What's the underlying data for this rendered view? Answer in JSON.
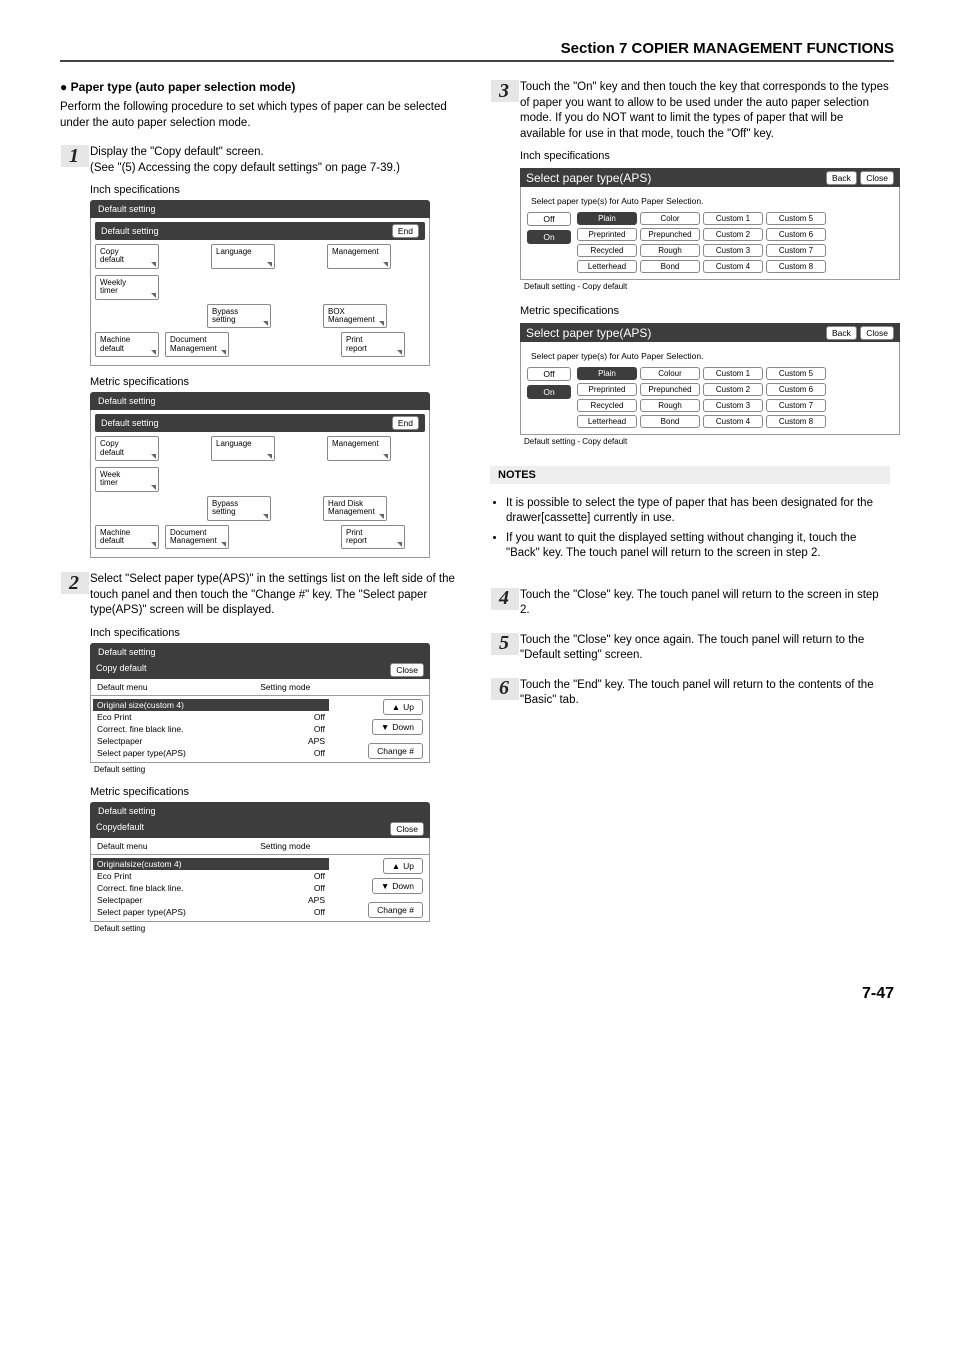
{
  "header": {
    "section_title": "Section 7  COPIER MANAGEMENT FUNCTIONS"
  },
  "left": {
    "heading": "Paper type (auto paper selection mode)",
    "intro": "Perform the following procedure to set which types of paper can be selected under the auto paper selection mode.",
    "step1_line1": "Display the \"Copy default\" screen.",
    "step1_line2": "(See \"(5) Accessing the copy default settings\" on page 7-39.)",
    "spec_inch": "Inch specifications",
    "spec_metric": "Metric specifications",
    "default_setting": "Default setting",
    "end": "End",
    "buttons_inch": {
      "copy_default": "Copy\ndefault",
      "machine_default": "Machine\ndefault",
      "document_mgmt": "Document\nManagement",
      "language": "Language",
      "bypass": "Bypass\nsetting",
      "management": "Management",
      "box_mgmt": "BOX\nManagement",
      "print_report": "Print\nreport",
      "weekly_timer": "Weekly\ntimer"
    },
    "buttons_metric": {
      "copy_default": "Copy\ndefault",
      "machine_default": "Machine\ndefault",
      "document_mgmt": "Document\nManagement",
      "language": "Language",
      "bypass": "Bypass\nsetting",
      "management": "Management",
      "hd_mgmt": "Hard Disk\nManagement",
      "print_report": "Print\nreport",
      "week_timer": "Week\ntimer"
    },
    "step2": "Select \"Select paper type(APS)\" in the settings list on the left side of the touch panel and then touch the \"Change #\" key. The \"Select paper type(APS)\" screen will be displayed.",
    "list_inch": {
      "title": "Default setting",
      "bar": "Copy default",
      "close": "Close",
      "menu": "Default menu",
      "mode": "Setting mode",
      "rows": [
        [
          "Original size(custom 4)",
          ""
        ],
        [
          "Eco Print",
          "Off"
        ],
        [
          "Correct. fine black line.",
          "Off"
        ],
        [
          "Selectpaper",
          "APS"
        ],
        [
          "Select paper type(APS)",
          "Off"
        ]
      ],
      "up": "Up",
      "down": "Down",
      "change": "Change #",
      "footer": "Default setting"
    },
    "list_metric": {
      "title": "Default setting",
      "bar": "Copydefault",
      "close": "Close",
      "menu": "Default menu",
      "mode": "Setting mode",
      "rows": [
        [
          "Originalsize(custom 4)",
          ""
        ],
        [
          "Eco Print",
          "Off"
        ],
        [
          "Correct. fine black line.",
          "Off"
        ],
        [
          "Selectpaper",
          "APS"
        ],
        [
          "Select paper type(APS)",
          "Off"
        ]
      ],
      "up": "Up",
      "down": "Down",
      "change": "Change #",
      "footer": "Default setting"
    }
  },
  "right": {
    "step3": "Touch the \"On\" key and then touch the key that corresponds to the types of paper you want to allow to be used under the auto paper selection mode. If you do NOT want to limit the types of paper that will be available for use in that mode, touch the \"Off\" key.",
    "spec_inch": "Inch specifications",
    "spec_metric": "Metric specifications",
    "aps_inch": {
      "title": "Select paper type(APS)",
      "back": "Back",
      "close": "Close",
      "sub": "Select paper type(s) for Auto Paper Selection.",
      "off": "Off",
      "on": "On",
      "cells": [
        "Plain",
        "Color",
        "Custom 1",
        "Custom 5",
        "Preprinted",
        "Prepunched",
        "Custom 2",
        "Custom 6",
        "Recycled",
        "Rough",
        "Custom 3",
        "Custom 7",
        "Letterhead",
        "Bond",
        "Custom 4",
        "Custom 8"
      ],
      "footer": "Default setting - Copy default"
    },
    "aps_metric": {
      "title": "Select paper type(APS)",
      "back": "Back",
      "close": "Close",
      "sub": "Select paper type(s) for Auto Paper Selection.",
      "off": "Off",
      "on": "On",
      "cells": [
        "Plain",
        "Colour",
        "Custom 1",
        "Custom 5",
        "Preprinted",
        "Prepunched",
        "Custom 2",
        "Custom 6",
        "Recycled",
        "Rough",
        "Custom 3",
        "Custom 7",
        "Letterhead",
        "Bond",
        "Custom 4",
        "Custom 8"
      ],
      "footer": "Default setting - Copy default"
    },
    "notes_label": "NOTES",
    "notes": [
      "It is possible to select the type of paper that has been designated for the drawer[cassette] currently in use.",
      "If you want to quit the displayed setting without changing it, touch the \"Back\" key. The touch panel will return to the screen in step 2."
    ],
    "step4": "Touch the \"Close\" key. The touch panel will return to the screen in step 2.",
    "step5": "Touch the \"Close\" key once again. The touch panel will return to the \"Default setting\" screen.",
    "step6": "Touch the \"End\" key. The touch panel will return to the contents of the \"Basic\" tab."
  },
  "page_number": "7-47"
}
